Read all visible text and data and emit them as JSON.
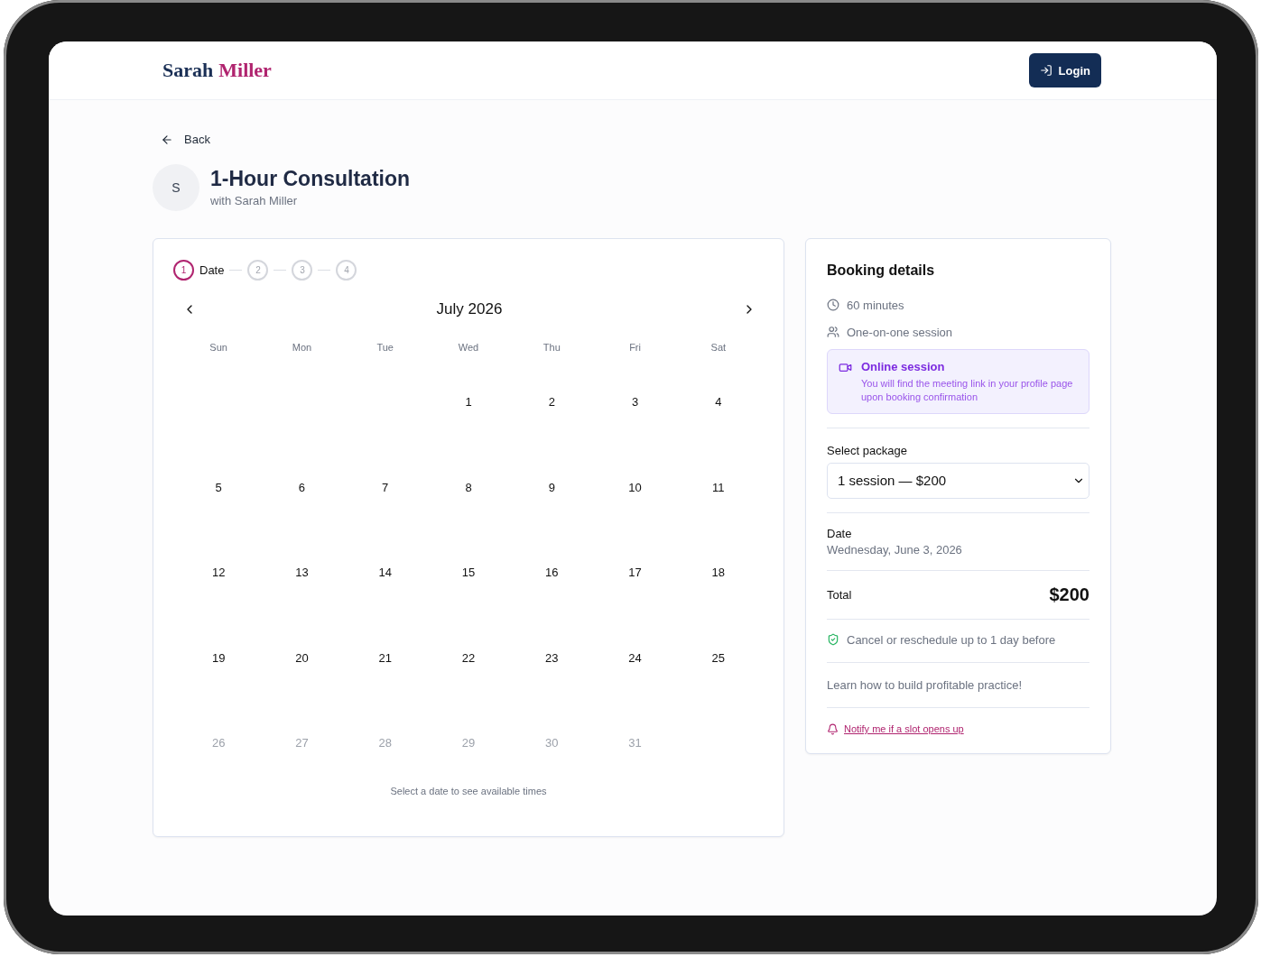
{
  "header": {
    "logo_first": "Sarah",
    "logo_last": "Miller",
    "login": "Login"
  },
  "back": "Back",
  "service": {
    "avatar": "S",
    "title": "1-Hour Consultation",
    "subtitle": "with Sarah Miller"
  },
  "steps": [
    {
      "number": "1",
      "label": "Date",
      "selected": true
    },
    {
      "number": "2",
      "selected": false
    },
    {
      "number": "3",
      "selected": false
    },
    {
      "number": "4",
      "selected": false
    }
  ],
  "calendar": {
    "month": "July 2026",
    "weekdays": [
      "Sun",
      "Mon",
      "Tue",
      "Wed",
      "Thu",
      "Fri",
      "Sat"
    ],
    "weeks": [
      [
        {
          "kind": "empty"
        },
        {
          "kind": "empty"
        },
        {
          "kind": "empty"
        },
        {
          "kind": "day",
          "label": "1",
          "disabled": false
        },
        {
          "kind": "day",
          "label": "2",
          "disabled": false
        },
        {
          "kind": "day",
          "label": "3",
          "disabled": false
        },
        {
          "kind": "day",
          "label": "4",
          "disabled": false
        }
      ],
      [
        {
          "kind": "day",
          "label": "5",
          "disabled": false
        },
        {
          "kind": "day",
          "label": "6",
          "disabled": false
        },
        {
          "kind": "day",
          "label": "7",
          "disabled": false
        },
        {
          "kind": "day",
          "label": "8",
          "disabled": false
        },
        {
          "kind": "day",
          "label": "9",
          "disabled": false
        },
        {
          "kind": "day",
          "label": "10",
          "disabled": false
        },
        {
          "kind": "day",
          "label": "11",
          "disabled": false
        }
      ],
      [
        {
          "kind": "day",
          "label": "12",
          "disabled": false
        },
        {
          "kind": "day",
          "label": "13",
          "disabled": false
        },
        {
          "kind": "day",
          "label": "14",
          "disabled": false
        },
        {
          "kind": "day",
          "label": "15",
          "disabled": false
        },
        {
          "kind": "day",
          "label": "16",
          "disabled": false
        },
        {
          "kind": "day",
          "label": "17",
          "disabled": false
        },
        {
          "kind": "day",
          "label": "18",
          "disabled": false
        }
      ],
      [
        {
          "kind": "day",
          "label": "19",
          "disabled": false
        },
        {
          "kind": "day",
          "label": "20",
          "disabled": false
        },
        {
          "kind": "day",
          "label": "21",
          "disabled": false
        },
        {
          "kind": "day",
          "label": "22",
          "disabled": false
        },
        {
          "kind": "day",
          "label": "23",
          "disabled": false
        },
        {
          "kind": "day",
          "label": "24",
          "disabled": false
        },
        {
          "kind": "day",
          "label": "25",
          "disabled": false
        }
      ],
      [
        {
          "kind": "day",
          "label": "26",
          "disabled": true
        },
        {
          "kind": "day",
          "label": "27",
          "disabled": true
        },
        {
          "kind": "day",
          "label": "28",
          "disabled": true
        },
        {
          "kind": "day",
          "label": "29",
          "disabled": true
        },
        {
          "kind": "day",
          "label": "30",
          "disabled": true
        },
        {
          "kind": "day",
          "label": "31",
          "disabled": true
        },
        {
          "kind": "empty"
        }
      ]
    ],
    "hint": "Select a date to see available times"
  },
  "booking": {
    "title": "Booking details",
    "duration": "60 minutes",
    "session_type": "One-on-one session",
    "online": {
      "title": "Online session",
      "text": "You will find the meeting link in your profile page upon booking confirmation"
    },
    "package_label": "Select package",
    "package": "1 session — $200",
    "date_label": "Date",
    "date": "Wednesday, June 3, 2026",
    "total_label": "Total",
    "total": "$200",
    "policy": "Cancel or reschedule up to 1 day before",
    "promo": "Learn how to build profitable practice!",
    "notify": "Notify me if a slot opens up"
  }
}
